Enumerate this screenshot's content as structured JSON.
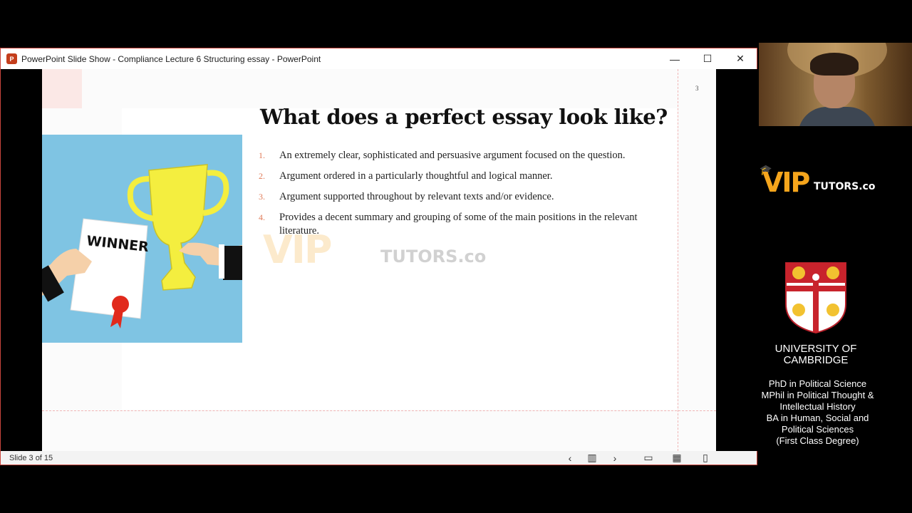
{
  "window": {
    "title": "PowerPoint Slide Show  -  Compliance Lecture 6 Structuring essay - PowerPoint",
    "minimize_label": "—",
    "maximize_label": "☐",
    "close_label": "✕"
  },
  "slide": {
    "number": "3",
    "title": "What does a perfect essay look like?",
    "illustration_text": "WINNER",
    "bullets": [
      {
        "num": "1.",
        "text": "An extremely clear, sophisticated and persuasive argument focused on the question."
      },
      {
        "num": "2.",
        "text": "Argument ordered in a particularly thoughtful and logical manner."
      },
      {
        "num": "3.",
        "text": "Argument supported throughout by relevant texts and/or evidence."
      },
      {
        "num": "4.",
        "text": "Provides a decent summary and grouping of some of the main positions in the relevant literature."
      }
    ],
    "watermark_vip": "VIP",
    "watermark_tutors": "TUTORS.co"
  },
  "statusbar": {
    "slide_counter": "Slide 3 of 15",
    "icons": [
      "previous-icon",
      "slide-sorter-icon",
      "next-icon",
      "presenter-view-icon",
      "grid-view-icon",
      "reading-view-icon"
    ]
  },
  "branding": {
    "vip": "VIP",
    "tutors": "TUTORS.co",
    "university": "UNIVERSITY OF CAMBRIDGE",
    "degrees": [
      "PhD in Political Science",
      "MPhil in Political Thought & Intellectual History",
      "BA in Human, Social and Political Sciences",
      "(First Class Degree)"
    ]
  },
  "colors": {
    "accent_number": "#e07b58",
    "vip_orange": "#f5a51c",
    "window_border": "#c9463d"
  }
}
